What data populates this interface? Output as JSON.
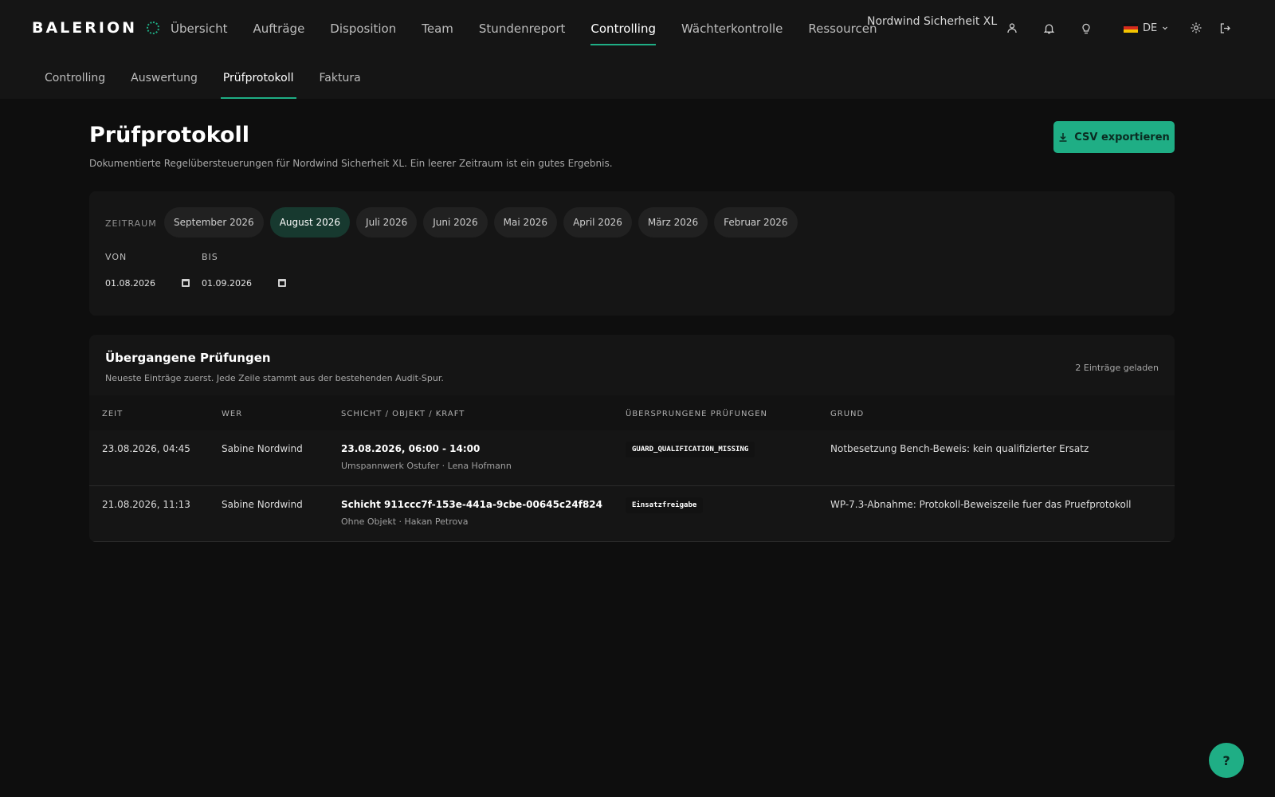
{
  "app": {
    "logo": "BALERION",
    "org_name": "Nordwind Sicherheit XL",
    "lang": "DE"
  },
  "main_nav": [
    {
      "label": "Übersicht"
    },
    {
      "label": "Aufträge"
    },
    {
      "label": "Disposition"
    },
    {
      "label": "Team"
    },
    {
      "label": "Stundenreport"
    },
    {
      "label": "Controlling",
      "active": true
    },
    {
      "label": "Wächterkontrolle"
    },
    {
      "label": "Ressourcen"
    }
  ],
  "top_icons": [
    "user-icon",
    "bell-icon",
    "lightbulb-icon",
    "gear-icon",
    "logout-icon"
  ],
  "sub_nav": [
    {
      "label": "Controlling"
    },
    {
      "label": "Auswertung"
    },
    {
      "label": "Prüfprotokoll",
      "active": true
    },
    {
      "label": "Faktura"
    }
  ],
  "page": {
    "title": "Prüfprotokoll",
    "subtitle": "Dokumentierte Regelübersteuerungen für Nordwind Sicherheit XL. Ein leerer Zeitraum ist ein gutes Ergebnis.",
    "csv_button": "CSV exportieren"
  },
  "period": {
    "label": "ZEITRAUM",
    "chips": [
      {
        "label": "September 2026"
      },
      {
        "label": "August 2026",
        "active": true
      },
      {
        "label": "Juli 2026"
      },
      {
        "label": "Juni 2026"
      },
      {
        "label": "Mai 2026"
      },
      {
        "label": "April 2026"
      },
      {
        "label": "März 2026"
      },
      {
        "label": "Februar 2026"
      }
    ],
    "from_label": "VON",
    "from_value": "01.08.2026",
    "to_label": "BIS",
    "to_value": "01.09.2026"
  },
  "table": {
    "title": "Übergangene Prüfungen",
    "subtitle": "Neueste Einträge zuerst. Jede Zeile stammt aus der bestehenden Audit-Spur.",
    "count": "2 Einträge geladen",
    "columns": [
      "ZEIT",
      "WER",
      "SCHICHT / OBJEKT / KRAFT",
      "ÜBERSPRUNGENE PRÜFUNGEN",
      "GRUND"
    ],
    "rows": [
      {
        "time": "23.08.2026, 04:45",
        "who": "Sabine Nordwind",
        "shift": "23.08.2026, 06:00 - 14:00",
        "shift_meta": "Umspannwerk Ostufer · Lena Hofmann",
        "skipped": "GUARD_QUALIFICATION_MISSING",
        "reason": "Notbesetzung Bench-Beweis: kein qualifizierter Ersatz"
      },
      {
        "time": "21.08.2026, 11:13",
        "who": "Sabine Nordwind",
        "shift": "Schicht 911ccc7f-153e-441a-9cbe-00645c24f824",
        "shift_meta": "Ohne Objekt · Hakan Petrova",
        "skipped": "Einsatzfreigabe",
        "reason": "WP-7.3-Abnahme: Protokoll-Beweiszeile fuer das Pruefprotokoll"
      }
    ]
  },
  "help": {
    "label": "?"
  },
  "colors": {
    "accent": "#1fae85",
    "background": "#0e0e0e",
    "surface": "#151515"
  }
}
